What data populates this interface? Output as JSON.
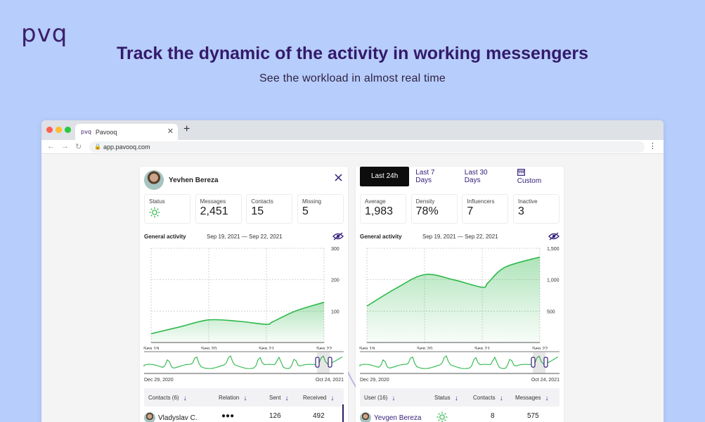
{
  "brand": {
    "logo": "pvq"
  },
  "hero": {
    "headline": "Track the dynamic of the activity in working messengers",
    "subheadline": "See the workload in almost real time"
  },
  "browser": {
    "tab_title": "Pavooq",
    "tab_favicon": "pvq",
    "url": "app.pavooq.com"
  },
  "left_card": {
    "user_name": "Yevhen Bereza",
    "stats": [
      {
        "label": "Status",
        "value": "",
        "icon": "sun-icon"
      },
      {
        "label": "Messages",
        "value": "2,451"
      },
      {
        "label": "Contacts",
        "value": "15"
      },
      {
        "label": "Missing",
        "value": "5"
      }
    ],
    "general_activity": {
      "title": "General activity",
      "range": "Sep 19, 2021 — Sep 22, 2021"
    },
    "mini_range": {
      "start": "Dec 29, 2020",
      "end": "Oct 24, 2021"
    },
    "table": {
      "headers": [
        "Contacts (6)",
        "Relation",
        "Sent",
        "Received"
      ],
      "row": {
        "name": "Vladyslav C.",
        "relation": "●●●",
        "sent": "126",
        "received": "492"
      }
    }
  },
  "right_card": {
    "periods": [
      "Last 24h",
      "Last 7 Days",
      "Last 30 Days",
      "Custom"
    ],
    "active_period": "Last 24h",
    "stats": [
      {
        "label": "Average",
        "value": "1,983"
      },
      {
        "label": "Density",
        "value": "78%"
      },
      {
        "label": "Influencers",
        "value": "7"
      },
      {
        "label": "Inactive",
        "value": "3"
      }
    ],
    "general_activity": {
      "title": "General activity",
      "range": "Sep 19, 2021 — Sep 22, 2021"
    },
    "mini_range": {
      "start": "Dec 29, 2020",
      "end": "Oct 24, 2021"
    },
    "table": {
      "headers": [
        "User (16)",
        "Status",
        "Contacts",
        "Messages"
      ],
      "row": {
        "name": "Yevgen Bereza",
        "status_icon": "sun-icon",
        "contacts": "8",
        "messages": "575"
      }
    }
  },
  "colors": {
    "accent": "#35207a",
    "line": "#2db84a",
    "fill": "#c8ecd0",
    "background": "#b7cdfb"
  },
  "chart_data": [
    {
      "type": "area",
      "x": [
        "Sep 19",
        "Sep 20",
        "Sep 21",
        "Sep 22"
      ],
      "y_ticks": [
        "300",
        "200",
        "100"
      ],
      "ylim": [
        0,
        300
      ],
      "series": [
        {
          "x": [
            0,
            0.5,
            1.0,
            1.5,
            2.0,
            2.1,
            2.5,
            3.0
          ],
          "values": [
            28,
            50,
            72,
            68,
            58,
            65,
            100,
            128
          ]
        }
      ]
    },
    {
      "type": "area",
      "x": [
        "Sep 19",
        "Sep 20",
        "Sep 21",
        "Sep 22"
      ],
      "y_ticks": [
        "1,500",
        "1,000",
        "500"
      ],
      "ylim": [
        0,
        1500
      ],
      "series": [
        {
          "x": [
            0,
            0.5,
            1.0,
            1.5,
            2.0,
            2.1,
            2.4,
            3.0
          ],
          "values": [
            580,
            860,
            1080,
            1000,
            880,
            950,
            1200,
            1360
          ]
        }
      ]
    }
  ]
}
